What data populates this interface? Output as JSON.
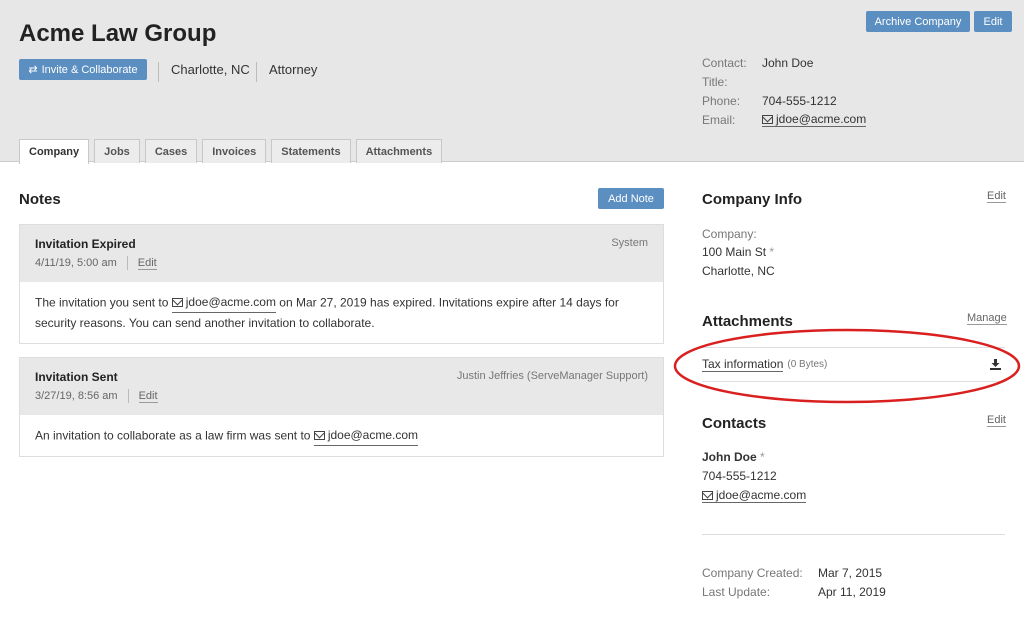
{
  "header": {
    "company_name": "Acme Law Group",
    "invite_label": "Invite & Collaborate",
    "city": "Charlotte, NC",
    "role": "Attorney",
    "archive_label": "Archive Company",
    "edit_label": "Edit"
  },
  "contact": {
    "contact_key": "Contact:",
    "contact_value": "John Doe",
    "title_key": "Title:",
    "title_value": "",
    "phone_key": "Phone:",
    "phone_value": "704-555-1212",
    "email_key": "Email:",
    "email_value": "jdoe@acme.com"
  },
  "tabs": [
    {
      "label": "Company",
      "active": true
    },
    {
      "label": "Jobs"
    },
    {
      "label": "Cases"
    },
    {
      "label": "Invoices"
    },
    {
      "label": "Statements"
    },
    {
      "label": "Attachments"
    }
  ],
  "notes": {
    "title": "Notes",
    "add_label": "Add Note",
    "items": [
      {
        "title": "Invitation Expired",
        "date": "4/11/19, 5:00 am",
        "edit": "Edit",
        "author": "System",
        "body_pre": "The invitation you sent to ",
        "body_email": "jdoe@acme.com",
        "body_post": " on Mar 27, 2019 has expired. Invitations expire after 14 days for security reasons. You can send another invitation to collaborate."
      },
      {
        "title": "Invitation Sent",
        "date": "3/27/19, 8:56 am",
        "edit": "Edit",
        "author": "Justin Jeffries (ServeManager Support)",
        "body_pre": "An invitation to collaborate as a law firm was sent to ",
        "body_email": "jdoe@acme.com",
        "body_post": ""
      }
    ]
  },
  "company_info": {
    "title": "Company Info",
    "edit": "Edit",
    "label": "Company:",
    "address1": "100 Main St",
    "star": "*",
    "address2": "Charlotte, NC"
  },
  "attachments": {
    "title": "Attachments",
    "manage": "Manage",
    "file_name": "Tax information",
    "file_size": "(0 Bytes)"
  },
  "contacts": {
    "title": "Contacts",
    "edit": "Edit",
    "name": "John Doe",
    "star": "*",
    "phone": "704-555-1212",
    "email": "jdoe@acme.com"
  },
  "footer": {
    "created_key": "Company Created:",
    "created_value": "Mar 7, 2015",
    "updated_key": "Last Update:",
    "updated_value": "Apr 11, 2019"
  },
  "colors": {
    "accent": "#5b8ec1",
    "annotation": "#d9201f"
  }
}
